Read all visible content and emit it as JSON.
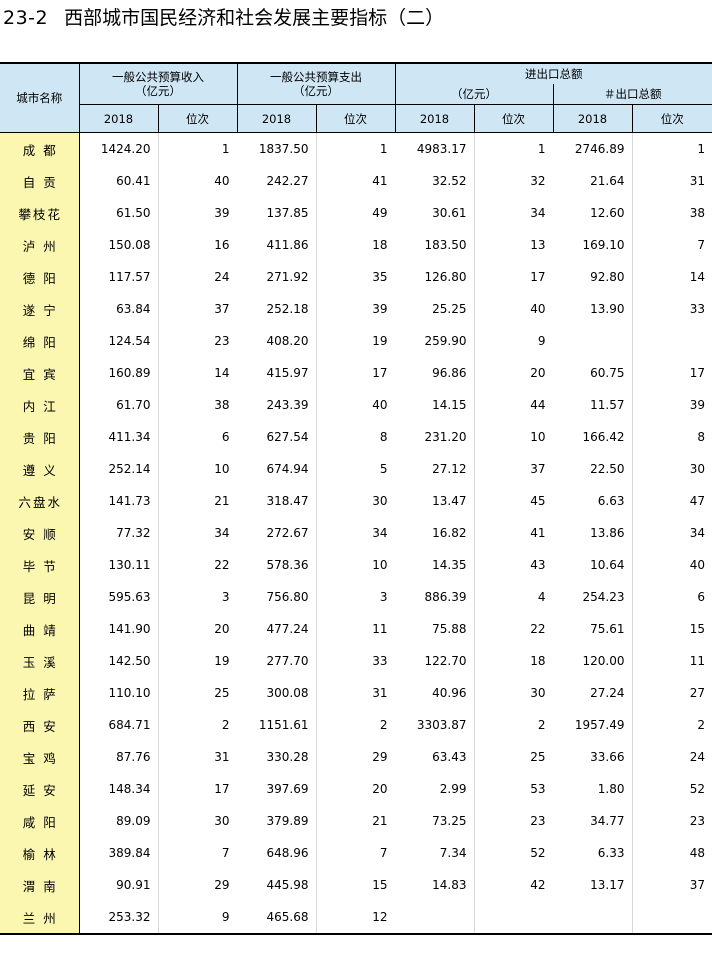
{
  "title": {
    "number": "23-2",
    "text": "西部城市国民经济和社会发展主要指标（二）"
  },
  "header": {
    "city_name": "城市名称",
    "budget_income": {
      "label": "一般公共预算收入",
      "unit": "（亿元）"
    },
    "budget_expense": {
      "label": "一般公共预算支出",
      "unit": "（亿元）"
    },
    "trade_total": {
      "label": "进出口总额",
      "unit": "（亿元）"
    },
    "export_total": {
      "label": "＃出口总额"
    },
    "year": "2018",
    "rank": "位次"
  },
  "rows": [
    {
      "city": "成都",
      "income": "1424.20",
      "income_rank": "1",
      "expense": "1837.50",
      "expense_rank": "1",
      "trade": "4983.17",
      "trade_rank": "1",
      "export": "2746.89",
      "export_rank": "1"
    },
    {
      "city": "自贡",
      "income": "60.41",
      "income_rank": "40",
      "expense": "242.27",
      "expense_rank": "41",
      "trade": "32.52",
      "trade_rank": "32",
      "export": "21.64",
      "export_rank": "31"
    },
    {
      "city": "攀枝花",
      "income": "61.50",
      "income_rank": "39",
      "expense": "137.85",
      "expense_rank": "49",
      "trade": "30.61",
      "trade_rank": "34",
      "export": "12.60",
      "export_rank": "38"
    },
    {
      "city": "泸州",
      "income": "150.08",
      "income_rank": "16",
      "expense": "411.86",
      "expense_rank": "18",
      "trade": "183.50",
      "trade_rank": "13",
      "export": "169.10",
      "export_rank": "7"
    },
    {
      "city": "德阳",
      "income": "117.57",
      "income_rank": "24",
      "expense": "271.92",
      "expense_rank": "35",
      "trade": "126.80",
      "trade_rank": "17",
      "export": "92.80",
      "export_rank": "14"
    },
    {
      "city": "遂宁",
      "income": "63.84",
      "income_rank": "37",
      "expense": "252.18",
      "expense_rank": "39",
      "trade": "25.25",
      "trade_rank": "40",
      "export": "13.90",
      "export_rank": "33"
    },
    {
      "city": "绵阳",
      "income": "124.54",
      "income_rank": "23",
      "expense": "408.20",
      "expense_rank": "19",
      "trade": "259.90",
      "trade_rank": "9",
      "export": "",
      "export_rank": ""
    },
    {
      "city": "宜宾",
      "income": "160.89",
      "income_rank": "14",
      "expense": "415.97",
      "expense_rank": "17",
      "trade": "96.86",
      "trade_rank": "20",
      "export": "60.75",
      "export_rank": "17"
    },
    {
      "city": "内江",
      "income": "61.70",
      "income_rank": "38",
      "expense": "243.39",
      "expense_rank": "40",
      "trade": "14.15",
      "trade_rank": "44",
      "export": "11.57",
      "export_rank": "39"
    },
    {
      "city": "贵阳",
      "income": "411.34",
      "income_rank": "6",
      "expense": "627.54",
      "expense_rank": "8",
      "trade": "231.20",
      "trade_rank": "10",
      "export": "166.42",
      "export_rank": "8"
    },
    {
      "city": "遵义",
      "income": "252.14",
      "income_rank": "10",
      "expense": "674.94",
      "expense_rank": "5",
      "trade": "27.12",
      "trade_rank": "37",
      "export": "22.50",
      "export_rank": "30"
    },
    {
      "city": "六盘水",
      "income": "141.73",
      "income_rank": "21",
      "expense": "318.47",
      "expense_rank": "30",
      "trade": "13.47",
      "trade_rank": "45",
      "export": "6.63",
      "export_rank": "47"
    },
    {
      "city": "安顺",
      "income": "77.32",
      "income_rank": "34",
      "expense": "272.67",
      "expense_rank": "34",
      "trade": "16.82",
      "trade_rank": "41",
      "export": "13.86",
      "export_rank": "34"
    },
    {
      "city": "毕节",
      "income": "130.11",
      "income_rank": "22",
      "expense": "578.36",
      "expense_rank": "10",
      "trade": "14.35",
      "trade_rank": "43",
      "export": "10.64",
      "export_rank": "40"
    },
    {
      "city": "昆明",
      "income": "595.63",
      "income_rank": "3",
      "expense": "756.80",
      "expense_rank": "3",
      "trade": "886.39",
      "trade_rank": "4",
      "export": "254.23",
      "export_rank": "6"
    },
    {
      "city": "曲靖",
      "income": "141.90",
      "income_rank": "20",
      "expense": "477.24",
      "expense_rank": "11",
      "trade": "75.88",
      "trade_rank": "22",
      "export": "75.61",
      "export_rank": "15"
    },
    {
      "city": "玉溪",
      "income": "142.50",
      "income_rank": "19",
      "expense": "277.70",
      "expense_rank": "33",
      "trade": "122.70",
      "trade_rank": "18",
      "export": "120.00",
      "export_rank": "11"
    },
    {
      "city": "拉萨",
      "income": "110.10",
      "income_rank": "25",
      "expense": "300.08",
      "expense_rank": "31",
      "trade": "40.96",
      "trade_rank": "30",
      "export": "27.24",
      "export_rank": "27"
    },
    {
      "city": "西安",
      "income": "684.71",
      "income_rank": "2",
      "expense": "1151.61",
      "expense_rank": "2",
      "trade": "3303.87",
      "trade_rank": "2",
      "export": "1957.49",
      "export_rank": "2"
    },
    {
      "city": "宝鸡",
      "income": "87.76",
      "income_rank": "31",
      "expense": "330.28",
      "expense_rank": "29",
      "trade": "63.43",
      "trade_rank": "25",
      "export": "33.66",
      "export_rank": "24"
    },
    {
      "city": "延安",
      "income": "148.34",
      "income_rank": "17",
      "expense": "397.69",
      "expense_rank": "20",
      "trade": "2.99",
      "trade_rank": "53",
      "export": "1.80",
      "export_rank": "52"
    },
    {
      "city": "咸阳",
      "income": "89.09",
      "income_rank": "30",
      "expense": "379.89",
      "expense_rank": "21",
      "trade": "73.25",
      "trade_rank": "23",
      "export": "34.77",
      "export_rank": "23"
    },
    {
      "city": "榆林",
      "income": "389.84",
      "income_rank": "7",
      "expense": "648.96",
      "expense_rank": "7",
      "trade": "7.34",
      "trade_rank": "52",
      "export": "6.33",
      "export_rank": "48"
    },
    {
      "city": "渭南",
      "income": "90.91",
      "income_rank": "29",
      "expense": "445.98",
      "expense_rank": "15",
      "trade": "14.83",
      "trade_rank": "42",
      "export": "13.17",
      "export_rank": "37"
    },
    {
      "city": "兰州",
      "income": "253.32",
      "income_rank": "9",
      "expense": "465.68",
      "expense_rank": "12",
      "trade": "",
      "trade_rank": "",
      "export": "",
      "export_rank": ""
    }
  ]
}
